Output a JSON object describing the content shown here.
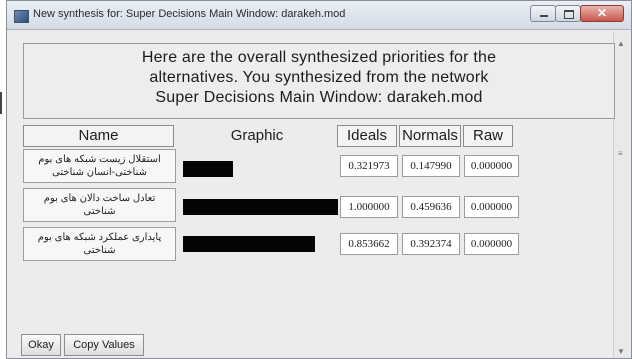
{
  "window": {
    "title": "New synthesis for: Super Decisions Main Window: darakeh.mod",
    "minimize_icon": "minimize-icon",
    "maximize_icon": "maximize-icon",
    "close_icon": "close-icon"
  },
  "message": {
    "line1": "Here are the overall synthesized priorities for the",
    "line2": "alternatives.  You synthesized from the network",
    "line3": "Super Decisions Main Window: darakeh.mod"
  },
  "table": {
    "headers": {
      "name": "Name",
      "graphic": "Graphic",
      "ideals": "Ideals",
      "normals": "Normals",
      "raw": "Raw"
    },
    "rows": [
      {
        "name": "استقلال زیست شبکه های بوم شناختی-انسان شناختی",
        "ideals": "0.321973",
        "normals": "0.147990",
        "raw": "0.000000",
        "bar_fraction": 0.321973
      },
      {
        "name": "تعادل ساخت دالان های بوم شناختی",
        "ideals": "1.000000",
        "normals": "0.459636",
        "raw": "0.000000",
        "bar_fraction": 1.0
      },
      {
        "name": "پایداری عملکرد شبکه های بوم شناختی",
        "ideals": "0.853662",
        "normals": "0.392374",
        "raw": "0.000000",
        "bar_fraction": 0.853662
      }
    ]
  },
  "buttons": {
    "okay": "Okay",
    "copy_values": "Copy Values"
  }
}
